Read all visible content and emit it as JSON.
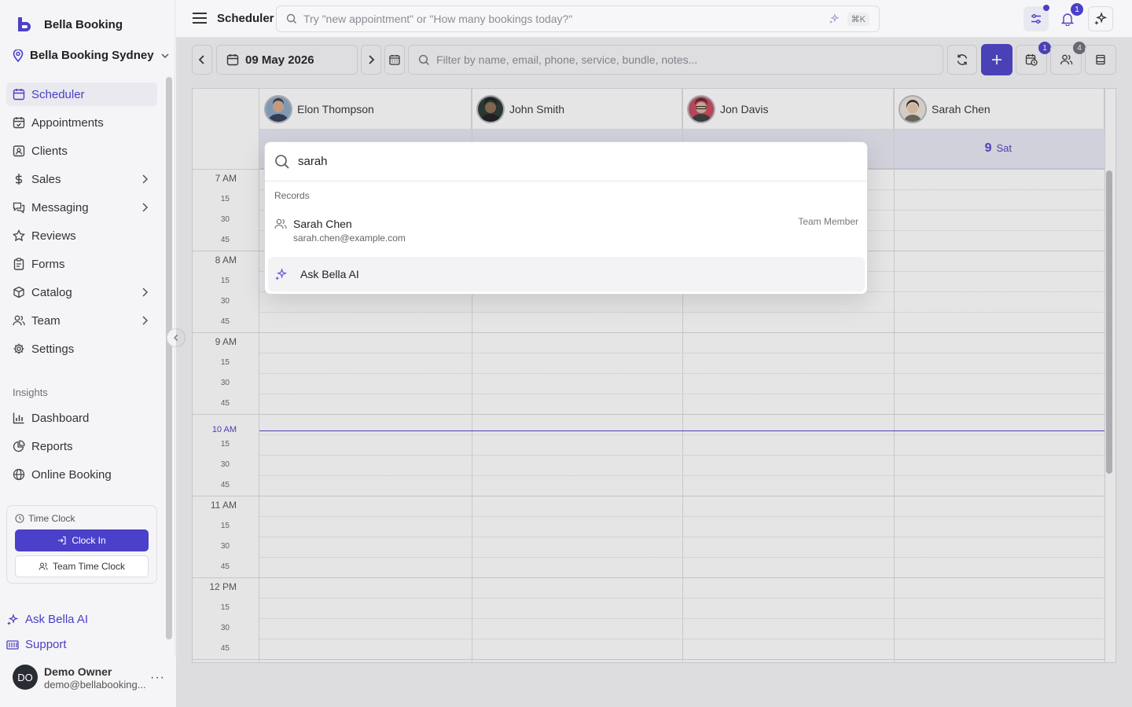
{
  "sidebar": {
    "brand": "Bella Booking",
    "location": "Bella Booking Sydney",
    "nav": [
      {
        "label": "Scheduler",
        "icon": "calendar-icon",
        "active": true
      },
      {
        "label": "Appointments",
        "icon": "calendar-check-icon"
      },
      {
        "label": "Clients",
        "icon": "contact-card-icon"
      },
      {
        "label": "Sales",
        "icon": "dollar-icon",
        "has_submenu": true
      },
      {
        "label": "Messaging",
        "icon": "messages-icon",
        "has_submenu": true
      },
      {
        "label": "Reviews",
        "icon": "star-icon"
      },
      {
        "label": "Forms",
        "icon": "clipboard-icon"
      },
      {
        "label": "Catalog",
        "icon": "box-icon",
        "has_submenu": true
      },
      {
        "label": "Team",
        "icon": "users-icon",
        "has_submenu": true
      },
      {
        "label": "Settings",
        "icon": "gear-icon"
      }
    ],
    "insights_label": "Insights",
    "insights": [
      {
        "label": "Dashboard",
        "icon": "bar-chart-icon"
      },
      {
        "label": "Reports",
        "icon": "pie-chart-icon"
      },
      {
        "label": "Online Booking",
        "icon": "globe-icon"
      }
    ],
    "time_clock": {
      "title": "Time Clock",
      "clock_in": "Clock In",
      "team_time_clock": "Team Time Clock"
    },
    "ask_bella": "Ask Bella AI",
    "support": "Support",
    "user": {
      "initials": "DO",
      "name": "Demo Owner",
      "email": "demo@bellabooking..."
    }
  },
  "header": {
    "title": "Scheduler",
    "search_placeholder": "Try \"new appointment\" or \"How many bookings today?\"",
    "shortcut": "⌘K",
    "notification_count": "1"
  },
  "toolbar": {
    "date": "09 May 2026",
    "filter_placeholder": "Filter by name, email, phone, service, bundle, notes...",
    "waitlist_badge": "1",
    "staff_badge": "4"
  },
  "calendar": {
    "staff": [
      {
        "name": "Elon Thompson"
      },
      {
        "name": "John Smith"
      },
      {
        "name": "Jon Davis"
      },
      {
        "name": "Sarah Chen"
      }
    ],
    "day_number": "9",
    "day_name": "Sat",
    "hours": [
      "7 AM",
      "8 AM",
      "9 AM",
      "10 AM",
      "11 AM",
      "12 PM"
    ],
    "quarters": [
      "15",
      "30",
      "45"
    ],
    "current_time_hour": "10 AM"
  },
  "command_palette": {
    "query": "sarah",
    "group_label": "Records",
    "record": {
      "name": "Sarah Chen",
      "email": "sarah.chen@example.com",
      "type": "Team Member"
    },
    "ask_label": "Ask Bella AI"
  },
  "colors": {
    "accent": "#4b40c9",
    "day_row": "#e8e8f3",
    "sidebar_bg": "#f5f5f7"
  }
}
